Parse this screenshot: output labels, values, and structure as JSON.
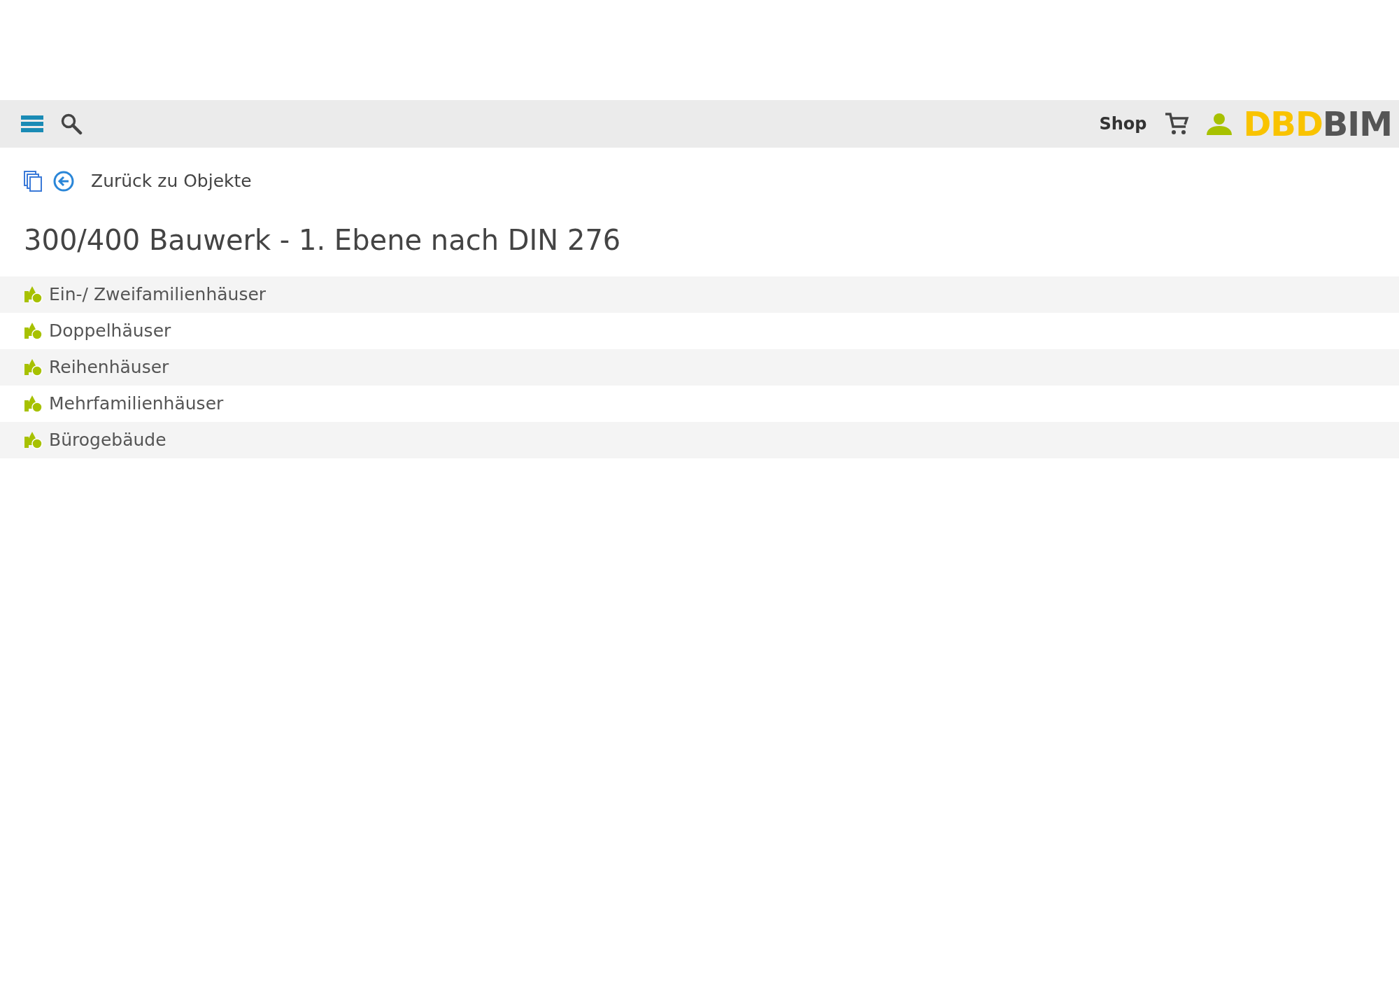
{
  "header": {
    "shop_label": "Shop",
    "logo": {
      "part_1": "DBD",
      "part_2": "BIM"
    }
  },
  "back_link": {
    "label": "Zurück zu Objekte"
  },
  "title": "300/400 Bauwerk - 1. Ebene nach DIN 276",
  "items": [
    {
      "label": "Ein-/ Zweifamilienhäuser"
    },
    {
      "label": "Doppelhäuser"
    },
    {
      "label": "Reihenhäuser"
    },
    {
      "label": "Mehrfamilienhäuser"
    },
    {
      "label": "Bürogebäude"
    }
  ]
}
